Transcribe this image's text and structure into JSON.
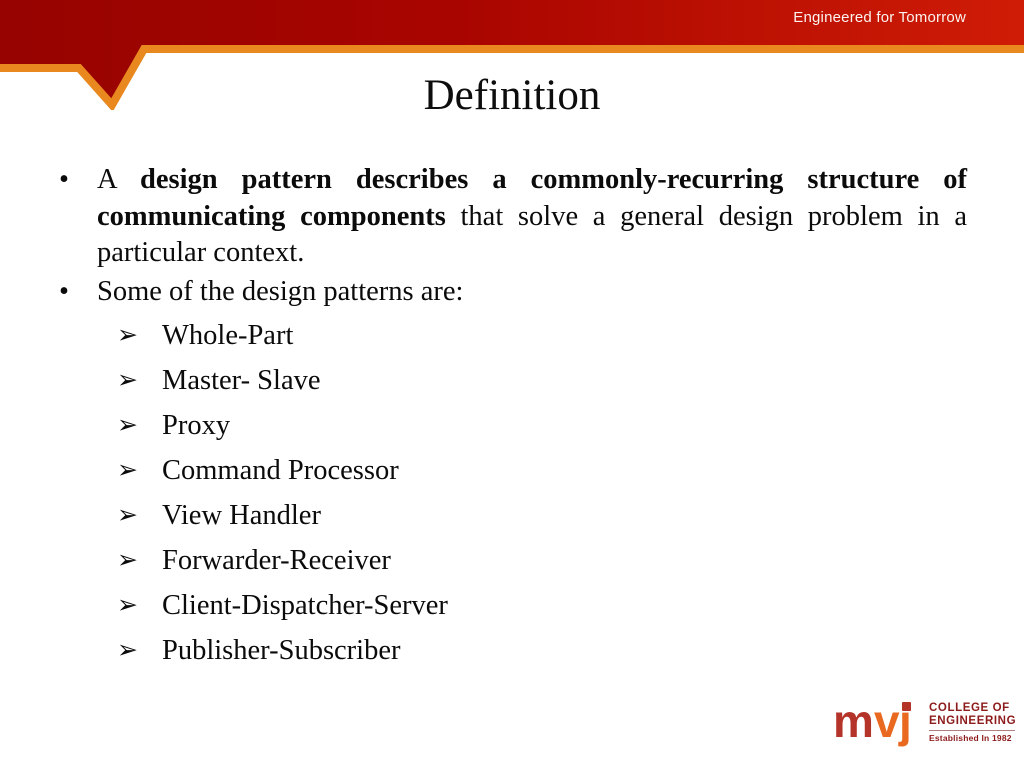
{
  "header": {
    "tagline": "Engineered for Tomorrow",
    "red_dark": "#9e0400",
    "red_light": "#cc1a05",
    "orange": "#e8881e"
  },
  "title": "Definition",
  "body": {
    "bullet_glyph": "•",
    "arrow_glyph": "➢",
    "bullets": [
      {
        "parts": [
          {
            "text": "A ",
            "bold": false
          },
          {
            "text": "design pattern describes a commonly-recurring structure of communicating components",
            "bold": true
          },
          {
            "text": " that solve a general design problem in a particular context.",
            "bold": false
          }
        ]
      },
      {
        "parts": [
          {
            "text": "Some of the design patterns are:",
            "bold": false
          }
        ]
      }
    ],
    "sub_items": [
      "Whole-Part",
      "Master- Slave",
      "Proxy",
      "Command Processor",
      "View Handler",
      "Forwarder-Receiver",
      "Client-Dispatcher-Server",
      "Publisher-Subscriber"
    ]
  },
  "logo": {
    "letters_m": "m",
    "letters_v": "v",
    "letters_j": "j",
    "line1": "COLLEGE OF",
    "line2": "ENGINEERING",
    "line3": "Established In 1982",
    "color_m": "#b4342a",
    "color_v": "#e8691f",
    "color_j": "#e8691f",
    "color_text": "#8d1b1b"
  }
}
